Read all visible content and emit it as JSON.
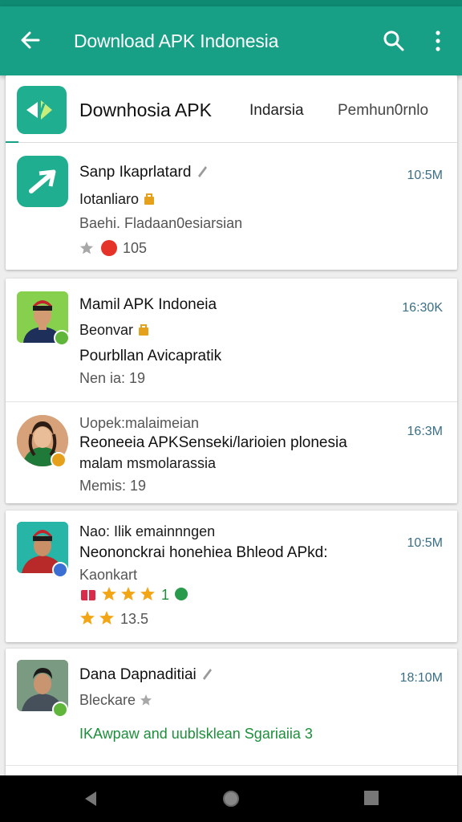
{
  "appbar": {
    "title": "Download APK Indonesia",
    "back_icon": "arrow-left-icon",
    "search_icon": "search-icon",
    "more_icon": "more-vert-icon",
    "color": "#17a086"
  },
  "header": {
    "title": "Downhosia APK",
    "tabs": [
      "Indarsia",
      "Pemhun0rnlo"
    ]
  },
  "card1": {
    "title": "Sanp Ikaprlatard",
    "line2": "Iotanliaro",
    "line3": "Baehi. Fladaan0esiarsian",
    "rating": "105",
    "time": "10:5M"
  },
  "card2": {
    "items": [
      {
        "title": "Mamil APK Indoneia",
        "line2": "Beonvar",
        "line3": "Pourbllan Avicapratik",
        "meta": "Nen ia: 19",
        "time": "16:30K"
      },
      {
        "title": "Uopek:malaimeian",
        "line2": "Reoneeia APKSenseki/larioien plonesia",
        "line3": "malam msmolarassia",
        "meta": "Memis: 19",
        "time": "16:3M"
      }
    ]
  },
  "card3": {
    "title": "Nao: Ilik emainnngen",
    "line2": "Neononckrai honehiea Bhleod APkd:",
    "line3": "Kaonkart",
    "rating_a": "1",
    "rating_b": "13.5",
    "time": "10:5M"
  },
  "card4": {
    "title": "Dana Dapnaditiai",
    "line2": "Bleckare",
    "line3": "IKAwpaw and uublsklean Sgariaiia 3",
    "time": "18:10M"
  },
  "navbar": {
    "back": "nav-back-icon",
    "home": "nav-home-icon",
    "recents": "nav-recents-icon"
  }
}
